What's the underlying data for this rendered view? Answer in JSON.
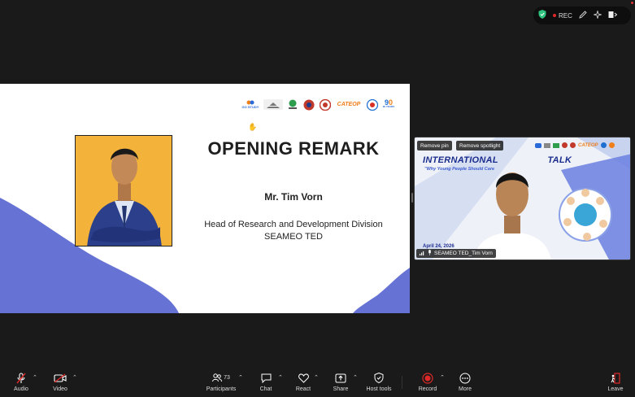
{
  "status": {
    "rec_label": "REC"
  },
  "slide": {
    "logos": [
      "GO STUDY",
      "UNESCO",
      "",
      "",
      "",
      "CATEOP",
      "",
      "90 YEARS"
    ],
    "title": "OPENING REMARK",
    "speaker": "Mr. Tim Vorn",
    "role_line1": "Head of Research and Development Division",
    "role_line2": "SEAMEO TED",
    "accent_color": "#6673d4"
  },
  "video_tile": {
    "remove_pin": "Remove pin",
    "remove_spotlight": "Remove spotlight",
    "banner_title": "INTERNATIONAL",
    "banner_title_right": "TALK",
    "banner_subtitle": "\"Why Young People Should Care",
    "banner_date": "April 24, 2026",
    "participant_name": "SEAMEO TED_Tim Vorn",
    "banner_logos": [
      "CATEOP"
    ]
  },
  "toolbar": {
    "audio": "Audio",
    "video": "Video",
    "participants": "Participants",
    "participants_count": "73",
    "chat": "Chat",
    "react": "React",
    "share": "Share",
    "host_tools": "Host tools",
    "record": "Record",
    "more": "More",
    "leave": "Leave",
    "record_color": "#e02828",
    "leave_color": "#e02828"
  }
}
